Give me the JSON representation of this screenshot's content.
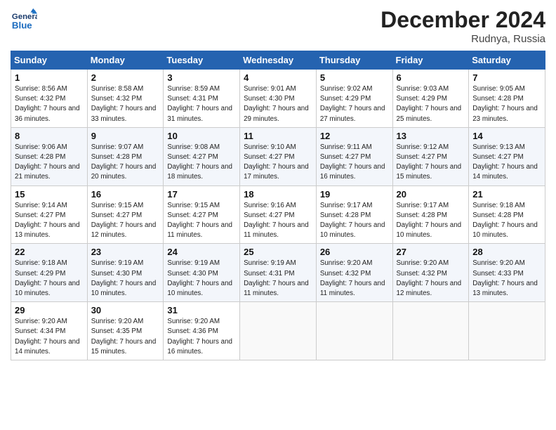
{
  "header": {
    "logo_general": "General",
    "logo_blue": "Blue",
    "month_title": "December 2024",
    "location": "Rudnya, Russia"
  },
  "weekdays": [
    "Sunday",
    "Monday",
    "Tuesday",
    "Wednesday",
    "Thursday",
    "Friday",
    "Saturday"
  ],
  "weeks": [
    [
      {
        "day": "1",
        "sunrise": "8:56 AM",
        "sunset": "4:32 PM",
        "daylight": "7 hours and 36 minutes."
      },
      {
        "day": "2",
        "sunrise": "8:58 AM",
        "sunset": "4:32 PM",
        "daylight": "7 hours and 33 minutes."
      },
      {
        "day": "3",
        "sunrise": "8:59 AM",
        "sunset": "4:31 PM",
        "daylight": "7 hours and 31 minutes."
      },
      {
        "day": "4",
        "sunrise": "9:01 AM",
        "sunset": "4:30 PM",
        "daylight": "7 hours and 29 minutes."
      },
      {
        "day": "5",
        "sunrise": "9:02 AM",
        "sunset": "4:29 PM",
        "daylight": "7 hours and 27 minutes."
      },
      {
        "day": "6",
        "sunrise": "9:03 AM",
        "sunset": "4:29 PM",
        "daylight": "7 hours and 25 minutes."
      },
      {
        "day": "7",
        "sunrise": "9:05 AM",
        "sunset": "4:28 PM",
        "daylight": "7 hours and 23 minutes."
      }
    ],
    [
      {
        "day": "8",
        "sunrise": "9:06 AM",
        "sunset": "4:28 PM",
        "daylight": "7 hours and 21 minutes."
      },
      {
        "day": "9",
        "sunrise": "9:07 AM",
        "sunset": "4:28 PM",
        "daylight": "7 hours and 20 minutes."
      },
      {
        "day": "10",
        "sunrise": "9:08 AM",
        "sunset": "4:27 PM",
        "daylight": "7 hours and 18 minutes."
      },
      {
        "day": "11",
        "sunrise": "9:10 AM",
        "sunset": "4:27 PM",
        "daylight": "7 hours and 17 minutes."
      },
      {
        "day": "12",
        "sunrise": "9:11 AM",
        "sunset": "4:27 PM",
        "daylight": "7 hours and 16 minutes."
      },
      {
        "day": "13",
        "sunrise": "9:12 AM",
        "sunset": "4:27 PM",
        "daylight": "7 hours and 15 minutes."
      },
      {
        "day": "14",
        "sunrise": "9:13 AM",
        "sunset": "4:27 PM",
        "daylight": "7 hours and 14 minutes."
      }
    ],
    [
      {
        "day": "15",
        "sunrise": "9:14 AM",
        "sunset": "4:27 PM",
        "daylight": "7 hours and 13 minutes."
      },
      {
        "day": "16",
        "sunrise": "9:15 AM",
        "sunset": "4:27 PM",
        "daylight": "7 hours and 12 minutes."
      },
      {
        "day": "17",
        "sunrise": "9:15 AM",
        "sunset": "4:27 PM",
        "daylight": "7 hours and 11 minutes."
      },
      {
        "day": "18",
        "sunrise": "9:16 AM",
        "sunset": "4:27 PM",
        "daylight": "7 hours and 11 minutes."
      },
      {
        "day": "19",
        "sunrise": "9:17 AM",
        "sunset": "4:28 PM",
        "daylight": "7 hours and 10 minutes."
      },
      {
        "day": "20",
        "sunrise": "9:17 AM",
        "sunset": "4:28 PM",
        "daylight": "7 hours and 10 minutes."
      },
      {
        "day": "21",
        "sunrise": "9:18 AM",
        "sunset": "4:28 PM",
        "daylight": "7 hours and 10 minutes."
      }
    ],
    [
      {
        "day": "22",
        "sunrise": "9:18 AM",
        "sunset": "4:29 PM",
        "daylight": "7 hours and 10 minutes."
      },
      {
        "day": "23",
        "sunrise": "9:19 AM",
        "sunset": "4:30 PM",
        "daylight": "7 hours and 10 minutes."
      },
      {
        "day": "24",
        "sunrise": "9:19 AM",
        "sunset": "4:30 PM",
        "daylight": "7 hours and 10 minutes."
      },
      {
        "day": "25",
        "sunrise": "9:19 AM",
        "sunset": "4:31 PM",
        "daylight": "7 hours and 11 minutes."
      },
      {
        "day": "26",
        "sunrise": "9:20 AM",
        "sunset": "4:32 PM",
        "daylight": "7 hours and 11 minutes."
      },
      {
        "day": "27",
        "sunrise": "9:20 AM",
        "sunset": "4:32 PM",
        "daylight": "7 hours and 12 minutes."
      },
      {
        "day": "28",
        "sunrise": "9:20 AM",
        "sunset": "4:33 PM",
        "daylight": "7 hours and 13 minutes."
      }
    ],
    [
      {
        "day": "29",
        "sunrise": "9:20 AM",
        "sunset": "4:34 PM",
        "daylight": "7 hours and 14 minutes."
      },
      {
        "day": "30",
        "sunrise": "9:20 AM",
        "sunset": "4:35 PM",
        "daylight": "7 hours and 15 minutes."
      },
      {
        "day": "31",
        "sunrise": "9:20 AM",
        "sunset": "4:36 PM",
        "daylight": "7 hours and 16 minutes."
      },
      null,
      null,
      null,
      null
    ]
  ]
}
